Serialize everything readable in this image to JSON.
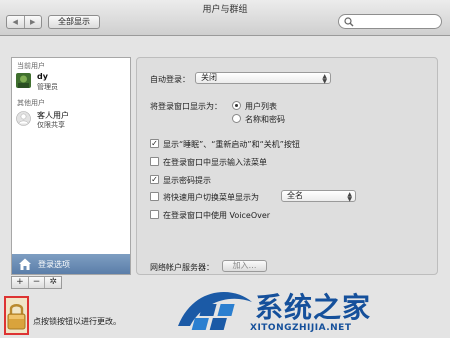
{
  "window": {
    "title": "用户与群组"
  },
  "toolbar": {
    "back": "◀",
    "forward": "▶",
    "show_all": "全部显示"
  },
  "sidebar": {
    "current_header": "当前用户",
    "current_user": {
      "name": "dy",
      "role": "管理员"
    },
    "other_header": "其他用户",
    "other_user": {
      "name": "客人用户",
      "role": "仅限共享"
    },
    "login_options": "登录选项",
    "buttons": {
      "add": "+",
      "remove": "−",
      "gear": "✲"
    }
  },
  "panel": {
    "auto_login_label": "自动登录：",
    "auto_login_value": "关闭",
    "display_as_label": "将登录窗口显示为：",
    "display_options": [
      "用户列表",
      "名称和密码"
    ],
    "checkboxes": [
      {
        "label": "显示“睡眠”、“重新启动”和“关机”按钮",
        "checked": true,
        "enabled": true
      },
      {
        "label": "在登录窗口中显示输入法菜单",
        "checked": false,
        "enabled": true
      },
      {
        "label": "显示密码提示",
        "checked": true,
        "enabled": true
      },
      {
        "label": "将快速用户切换菜单显示为",
        "checked": false,
        "enabled": true
      },
      {
        "label": "在登录窗口中使用 VoiceOver",
        "checked": false,
        "enabled": true
      }
    ],
    "fast_switch_value": "全名",
    "network_server_label": "网络帐户服务器：",
    "network_server_button": "加入…"
  },
  "lock": {
    "text": "点按锁按钮以进行更改。"
  },
  "watermark": {
    "cn": "系统之家",
    "en": "XITONGZHIJIA.NET"
  }
}
